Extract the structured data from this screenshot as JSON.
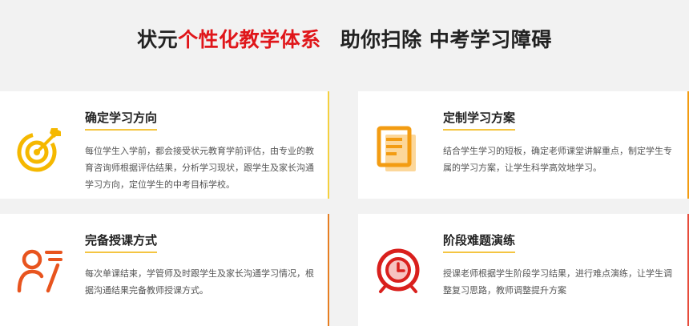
{
  "headline": {
    "part1": "状元",
    "part2": "个性化教学体系",
    "part3": "助你扫除 中考学习障碍"
  },
  "cards": [
    {
      "title": "确定学习方向",
      "desc": "每位学生入学前，都会接受状元教育学前评估，由专业的教育咨询师根据评估结果，分析学习现状，跟学生及家长沟通学习方向，定位学生的中考目标学校。",
      "icon": "target-icon",
      "icon_color": "#f5b800"
    },
    {
      "title": "定制学习方案",
      "desc": "结合学生学习的短板，确定老师课堂讲解重点，制定学生专属的学习方案，让学生科学高效地学习。",
      "icon": "document-icon",
      "icon_color": "#f39c12"
    },
    {
      "title": "完备授课方式",
      "desc": "每次单课结束，学管师及时跟学生及家长沟通学习情况，根据沟通结果完备教师授课方式。",
      "icon": "teacher-icon",
      "icon_color": "#e8541e"
    },
    {
      "title": "阶段难题演练",
      "desc": "授课老师根据学生阶段学习结果，进行难点演练，让学生调整复习思路，教师调整提升方案",
      "icon": "alarm-clock-icon",
      "icon_color": "#d9201d"
    }
  ]
}
